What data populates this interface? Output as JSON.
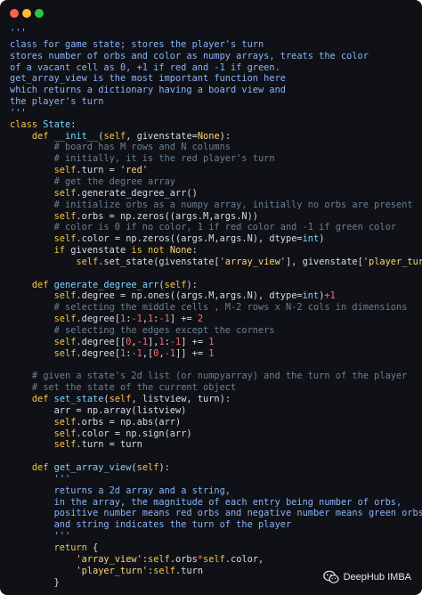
{
  "window": {
    "controls": [
      "close",
      "minimize",
      "maximize"
    ],
    "colors": {
      "close": "#ff5f57",
      "minimize": "#febc2e",
      "maximize": "#28c840",
      "background": "#0f1116"
    }
  },
  "code_lines": [
    [
      {
        "t": "str",
        "v": "'''"
      }
    ],
    [
      {
        "t": "str",
        "v": "class for game state; stores the player's turn"
      }
    ],
    [
      {
        "t": "str",
        "v": "stores number of orbs and color as numpy arrays, treats the color"
      }
    ],
    [
      {
        "t": "str",
        "v": "of a vacant cell as 0, +1 if red and -1 if green."
      }
    ],
    [
      {
        "t": "str",
        "v": "get_array_view is the most important function here"
      }
    ],
    [
      {
        "t": "str",
        "v": "which returns a dictionary having a board view and"
      }
    ],
    [
      {
        "t": "str",
        "v": "the player's turn"
      }
    ],
    [
      {
        "t": "str",
        "v": "'''"
      }
    ],
    [
      {
        "t": "kw",
        "v": "class "
      },
      {
        "t": "name",
        "v": "State"
      },
      {
        "t": "plain",
        "v": ":"
      }
    ],
    [
      {
        "t": "plain",
        "v": "    "
      },
      {
        "t": "kw",
        "v": "def "
      },
      {
        "t": "fn",
        "v": "__init__"
      },
      {
        "t": "plain",
        "v": "("
      },
      {
        "t": "self",
        "v": "self"
      },
      {
        "t": "plain",
        "v": ", givenstate="
      },
      {
        "t": "lit",
        "v": "None"
      },
      {
        "t": "plain",
        "v": "):"
      }
    ],
    [
      {
        "t": "plain",
        "v": "        "
      },
      {
        "t": "cmt",
        "v": "# board has M rows and N columns"
      }
    ],
    [
      {
        "t": "plain",
        "v": "        "
      },
      {
        "t": "cmt",
        "v": "# initially, it is the red player's turn"
      }
    ],
    [
      {
        "t": "plain",
        "v": "        "
      },
      {
        "t": "self",
        "v": "self"
      },
      {
        "t": "plain",
        "v": ".turn = "
      },
      {
        "t": "lit",
        "v": "'red'"
      }
    ],
    [
      {
        "t": "plain",
        "v": "        "
      },
      {
        "t": "cmt",
        "v": "# get the degree array"
      }
    ],
    [
      {
        "t": "plain",
        "v": "        "
      },
      {
        "t": "self",
        "v": "self"
      },
      {
        "t": "plain",
        "v": ".generate_degree_arr()"
      }
    ],
    [
      {
        "t": "plain",
        "v": "        "
      },
      {
        "t": "cmt",
        "v": "# initialize orbs as a numpy array, initially no orbs are present"
      }
    ],
    [
      {
        "t": "plain",
        "v": "        "
      },
      {
        "t": "self",
        "v": "self"
      },
      {
        "t": "plain",
        "v": ".orbs = np.zeros((args.M,args.N))"
      }
    ],
    [
      {
        "t": "plain",
        "v": "        "
      },
      {
        "t": "cmt",
        "v": "# color is 0 if no color, 1 if red color and -1 if green color"
      }
    ],
    [
      {
        "t": "plain",
        "v": "        "
      },
      {
        "t": "self",
        "v": "self"
      },
      {
        "t": "plain",
        "v": ".color = np.zeros((args.M,args.N), dtype="
      },
      {
        "t": "fn",
        "v": "int"
      },
      {
        "t": "plain",
        "v": ")"
      }
    ],
    [
      {
        "t": "plain",
        "v": "        "
      },
      {
        "t": "kw",
        "v": "if "
      },
      {
        "t": "plain",
        "v": "givenstate "
      },
      {
        "t": "kw",
        "v": "is not "
      },
      {
        "t": "lit",
        "v": "None"
      },
      {
        "t": "plain",
        "v": ":"
      }
    ],
    [
      {
        "t": "plain",
        "v": "            "
      },
      {
        "t": "self",
        "v": "self"
      },
      {
        "t": "plain",
        "v": ".set_state(givenstate["
      },
      {
        "t": "lit",
        "v": "'array_view'"
      },
      {
        "t": "plain",
        "v": "], givenstate["
      },
      {
        "t": "lit",
        "v": "'player_turn'"
      },
      {
        "t": "plain",
        "v": "])"
      }
    ],
    [
      {
        "t": "plain",
        "v": ""
      }
    ],
    [
      {
        "t": "plain",
        "v": "    "
      },
      {
        "t": "kw",
        "v": "def "
      },
      {
        "t": "fn",
        "v": "generate_degree_arr"
      },
      {
        "t": "plain",
        "v": "("
      },
      {
        "t": "self",
        "v": "self"
      },
      {
        "t": "plain",
        "v": "):"
      }
    ],
    [
      {
        "t": "plain",
        "v": "        "
      },
      {
        "t": "self",
        "v": "self"
      },
      {
        "t": "plain",
        "v": ".degree = np.ones((args.M,args.N), dtype="
      },
      {
        "t": "fn",
        "v": "int"
      },
      {
        "t": "plain",
        "v": ")"
      },
      {
        "t": "op",
        "v": "+1"
      }
    ],
    [
      {
        "t": "plain",
        "v": "        "
      },
      {
        "t": "cmt",
        "v": "# selecting the middle cells , M-2 rows x N-2 cols in dimensions"
      }
    ],
    [
      {
        "t": "plain",
        "v": "        "
      },
      {
        "t": "self",
        "v": "self"
      },
      {
        "t": "plain",
        "v": ".degree["
      },
      {
        "t": "num",
        "v": "1"
      },
      {
        "t": "plain",
        "v": ":"
      },
      {
        "t": "op",
        "v": "-1"
      },
      {
        "t": "plain",
        "v": ","
      },
      {
        "t": "num",
        "v": "1"
      },
      {
        "t": "plain",
        "v": ":"
      },
      {
        "t": "op",
        "v": "-1"
      },
      {
        "t": "plain",
        "v": "] += "
      },
      {
        "t": "num",
        "v": "2"
      }
    ],
    [
      {
        "t": "plain",
        "v": "        "
      },
      {
        "t": "cmt",
        "v": "# selecting the edges except the corners"
      }
    ],
    [
      {
        "t": "plain",
        "v": "        "
      },
      {
        "t": "self",
        "v": "self"
      },
      {
        "t": "plain",
        "v": ".degree[["
      },
      {
        "t": "num",
        "v": "0"
      },
      {
        "t": "plain",
        "v": ","
      },
      {
        "t": "op",
        "v": "-1"
      },
      {
        "t": "plain",
        "v": "],"
      },
      {
        "t": "num",
        "v": "1"
      },
      {
        "t": "plain",
        "v": ":"
      },
      {
        "t": "op",
        "v": "-1"
      },
      {
        "t": "plain",
        "v": "] += "
      },
      {
        "t": "num",
        "v": "1"
      }
    ],
    [
      {
        "t": "plain",
        "v": "        "
      },
      {
        "t": "self",
        "v": "self"
      },
      {
        "t": "plain",
        "v": ".degree["
      },
      {
        "t": "num",
        "v": "1"
      },
      {
        "t": "plain",
        "v": ":"
      },
      {
        "t": "op",
        "v": "-1"
      },
      {
        "t": "plain",
        "v": ",["
      },
      {
        "t": "num",
        "v": "0"
      },
      {
        "t": "plain",
        "v": ","
      },
      {
        "t": "op",
        "v": "-1"
      },
      {
        "t": "plain",
        "v": "]] += "
      },
      {
        "t": "num",
        "v": "1"
      }
    ],
    [
      {
        "t": "plain",
        "v": ""
      }
    ],
    [
      {
        "t": "plain",
        "v": "    "
      },
      {
        "t": "cmt",
        "v": "# given a state's 2d list (or numpyarray) and the turn of the player"
      }
    ],
    [
      {
        "t": "plain",
        "v": "    "
      },
      {
        "t": "cmt",
        "v": "# set the state of the current object"
      }
    ],
    [
      {
        "t": "plain",
        "v": "    "
      },
      {
        "t": "kw",
        "v": "def "
      },
      {
        "t": "fn",
        "v": "set_state"
      },
      {
        "t": "plain",
        "v": "("
      },
      {
        "t": "self",
        "v": "self"
      },
      {
        "t": "plain",
        "v": ", listview, turn):"
      }
    ],
    [
      {
        "t": "plain",
        "v": "        arr = np.array(listview)"
      }
    ],
    [
      {
        "t": "plain",
        "v": "        "
      },
      {
        "t": "self",
        "v": "self"
      },
      {
        "t": "plain",
        "v": ".orbs = np.abs(arr)"
      }
    ],
    [
      {
        "t": "plain",
        "v": "        "
      },
      {
        "t": "self",
        "v": "self"
      },
      {
        "t": "plain",
        "v": ".color = np.sign(arr)"
      }
    ],
    [
      {
        "t": "plain",
        "v": "        "
      },
      {
        "t": "self",
        "v": "self"
      },
      {
        "t": "plain",
        "v": ".turn = turn"
      }
    ],
    [
      {
        "t": "plain",
        "v": ""
      }
    ],
    [
      {
        "t": "plain",
        "v": "    "
      },
      {
        "t": "kw",
        "v": "def "
      },
      {
        "t": "fn",
        "v": "get_array_view"
      },
      {
        "t": "plain",
        "v": "("
      },
      {
        "t": "self",
        "v": "self"
      },
      {
        "t": "plain",
        "v": "):"
      }
    ],
    [
      {
        "t": "plain",
        "v": "        "
      },
      {
        "t": "str",
        "v": "'''"
      }
    ],
    [
      {
        "t": "plain",
        "v": "        "
      },
      {
        "t": "str",
        "v": "returns a 2d array and a string,"
      }
    ],
    [
      {
        "t": "plain",
        "v": "        "
      },
      {
        "t": "str",
        "v": "in the array, the magnitude of each entry being number of orbs,"
      }
    ],
    [
      {
        "t": "plain",
        "v": "        "
      },
      {
        "t": "str",
        "v": "positive number means red orbs and negative number means green orbs"
      }
    ],
    [
      {
        "t": "plain",
        "v": "        "
      },
      {
        "t": "str",
        "v": "and string indicates the turn of the player"
      }
    ],
    [
      {
        "t": "plain",
        "v": "        "
      },
      {
        "t": "str",
        "v": "'''"
      }
    ],
    [
      {
        "t": "plain",
        "v": "        "
      },
      {
        "t": "kw",
        "v": "return "
      },
      {
        "t": "plain",
        "v": "{"
      }
    ],
    [
      {
        "t": "plain",
        "v": "            "
      },
      {
        "t": "lit",
        "v": "'array_view'"
      },
      {
        "t": "plain",
        "v": ":"
      },
      {
        "t": "self",
        "v": "self"
      },
      {
        "t": "plain",
        "v": ".orbs"
      },
      {
        "t": "op",
        "v": "*"
      },
      {
        "t": "self",
        "v": "self"
      },
      {
        "t": "plain",
        "v": ".color,"
      }
    ],
    [
      {
        "t": "plain",
        "v": "            "
      },
      {
        "t": "lit",
        "v": "'player_turn'"
      },
      {
        "t": "plain",
        "v": ":"
      },
      {
        "t": "self",
        "v": "self"
      },
      {
        "t": "plain",
        "v": ".turn"
      }
    ],
    [
      {
        "t": "plain",
        "v": "        }"
      }
    ]
  ],
  "watermark": {
    "icon": "wechat-icon",
    "text": "DeepHub IMBA"
  }
}
